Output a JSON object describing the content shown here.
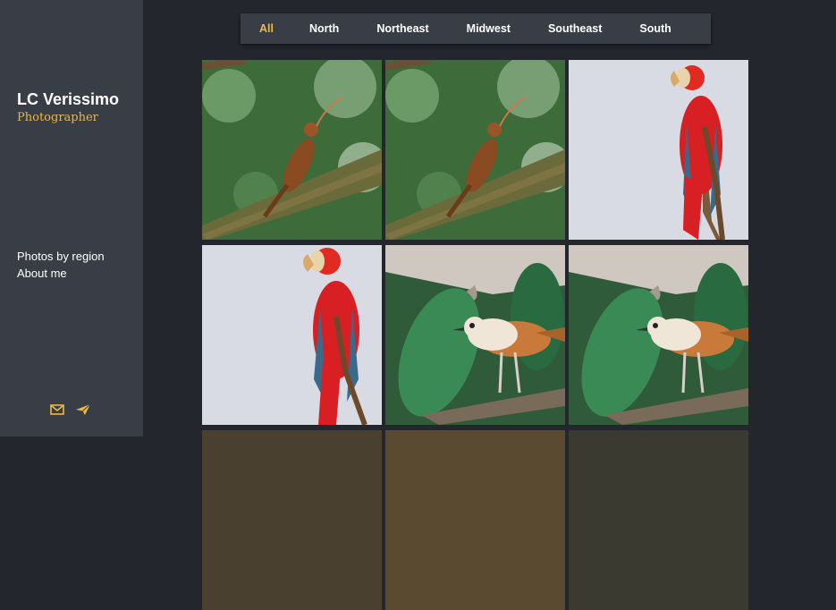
{
  "brand": {
    "name": "LC Verissimo",
    "role": "Photographer"
  },
  "sidebar": {
    "links": [
      {
        "label": "Photos by region"
      },
      {
        "label": "About me"
      }
    ],
    "icons": [
      "mail-icon",
      "paper-plane-icon"
    ]
  },
  "tabs": [
    {
      "label": "All",
      "active": true
    },
    {
      "label": "North",
      "active": false
    },
    {
      "label": "Northeast",
      "active": false
    },
    {
      "label": "Midwest",
      "active": false
    },
    {
      "label": "Southeast",
      "active": false
    },
    {
      "label": "South",
      "active": false
    }
  ],
  "colors": {
    "page_bg": "#23262d",
    "sidebar_bg": "#393d46",
    "accent": "#e9b949",
    "text": "#ffffff"
  },
  "gallery": {
    "photos": [
      {
        "subject": "woodcreeper-on-branch"
      },
      {
        "subject": "woodcreeper-on-branch"
      },
      {
        "subject": "scarlet-macaw"
      },
      {
        "subject": "scarlet-macaw"
      },
      {
        "subject": "wren-bird-on-branch"
      },
      {
        "subject": "wren-bird-on-branch"
      }
    ]
  }
}
